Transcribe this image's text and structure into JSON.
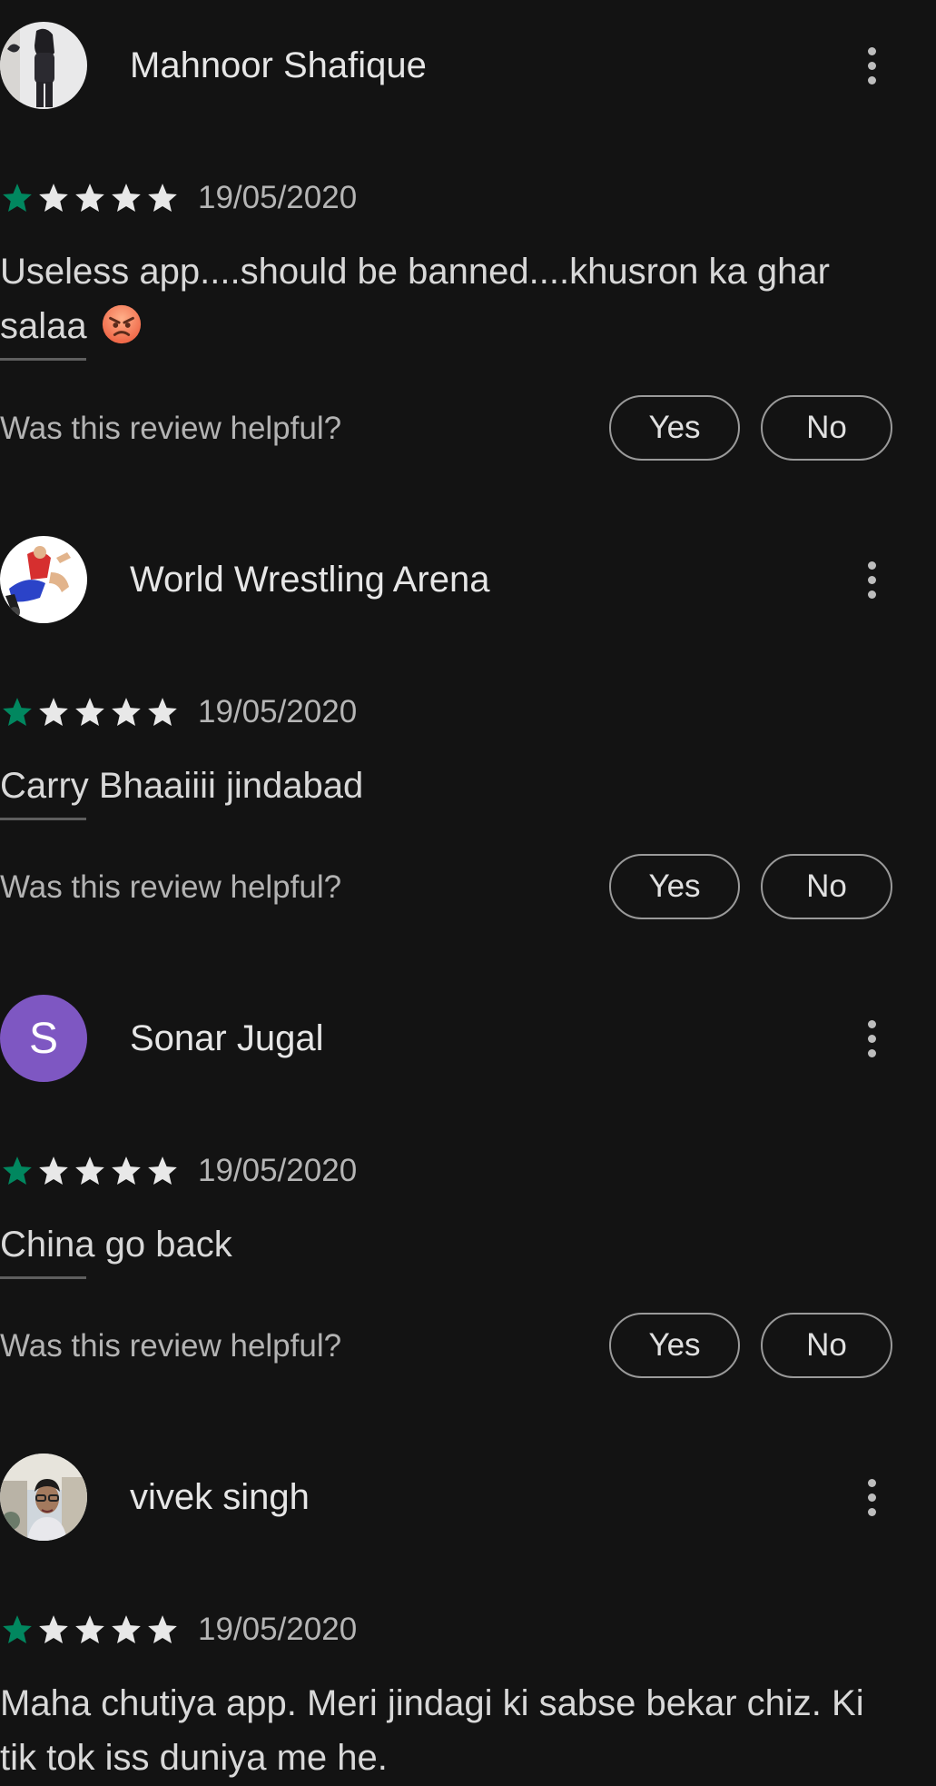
{
  "helpful_question": "Was this review helpful?",
  "yes_label": "Yes",
  "no_label": "No",
  "colors": {
    "background": "#131313",
    "star_filled": "#01875f",
    "star_empty": "#e8e8e8",
    "avatar_letter_bg": "#7e57c2"
  },
  "reviews": [
    {
      "name": "Mahnoor Shafique",
      "avatar": "photo",
      "rating": 1,
      "max_rating": 5,
      "date": "19/05/2020",
      "text": "Useless app....should be banned....khusron ka ghar salaa",
      "emoji": "angry-face-icon"
    },
    {
      "name": "World Wrestling Arena",
      "avatar": "photo",
      "rating": 1,
      "max_rating": 5,
      "date": "19/05/2020",
      "text": "Carry Bhaaiiii jindabad"
    },
    {
      "name": "Sonar Jugal",
      "avatar": "letter",
      "avatar_letter": "S",
      "rating": 1,
      "max_rating": 5,
      "date": "19/05/2020",
      "text": "China go back"
    },
    {
      "name": "vivek singh",
      "avatar": "photo",
      "rating": 1,
      "max_rating": 5,
      "date": "19/05/2020",
      "text": "Maha chutiya app. Meri jindagi ki sabse bekar chiz. Ki tik tok iss duniya me he."
    }
  ]
}
